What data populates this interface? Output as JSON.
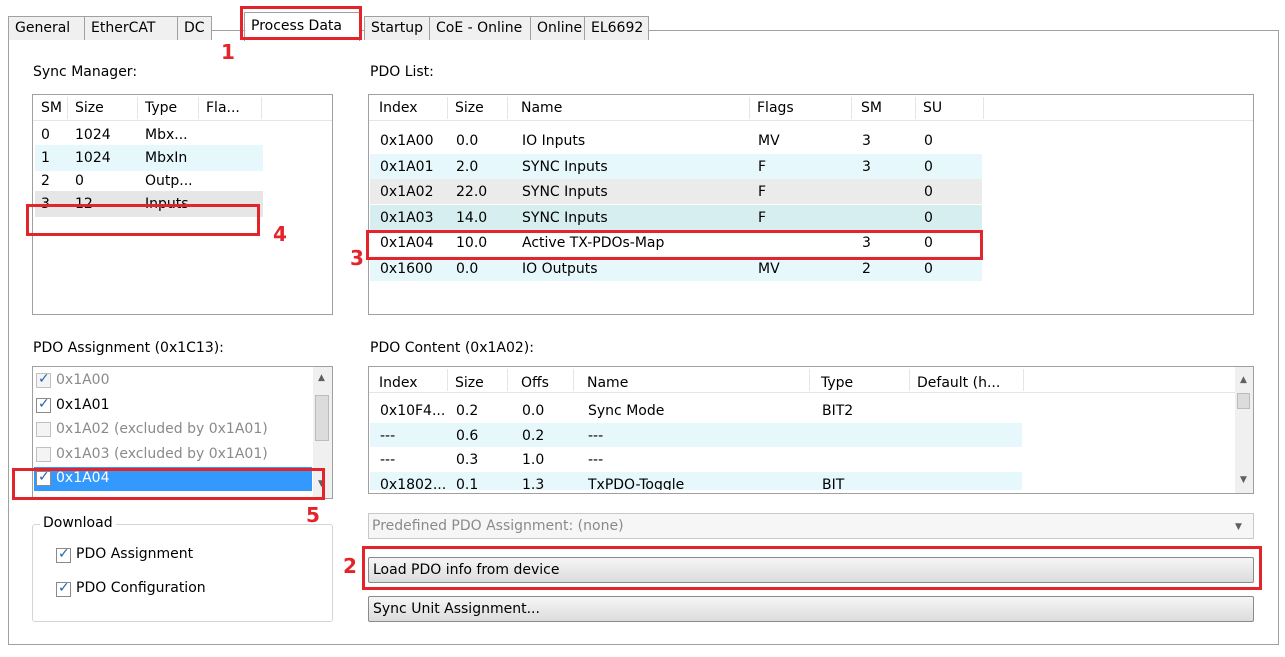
{
  "tabs": [
    "General",
    "EtherCAT",
    "DC",
    "Process Data",
    "Startup",
    "CoE - Online",
    "Online",
    "EL6692"
  ],
  "sync_manager": {
    "label": "Sync Manager:",
    "columns": [
      "SM",
      "Size",
      "Type",
      "Fla..."
    ],
    "rows": [
      {
        "sm": "0",
        "size": "1024",
        "type": "Mbx..."
      },
      {
        "sm": "1",
        "size": "1024",
        "type": "MbxIn"
      },
      {
        "sm": "2",
        "size": "0",
        "type": "Outp..."
      },
      {
        "sm": "3",
        "size": "12",
        "type": "Inputs"
      }
    ]
  },
  "pdo_list": {
    "label": "PDO List:",
    "columns": [
      "Index",
      "Size",
      "Name",
      "Flags",
      "SM",
      "SU"
    ],
    "rows": [
      {
        "index": "0x1A00",
        "size": "0.0",
        "name": "IO Inputs",
        "flags": "MV",
        "sm": "3",
        "su": "0"
      },
      {
        "index": "0x1A01",
        "size": "2.0",
        "name": "SYNC Inputs",
        "flags": "F",
        "sm": "3",
        "su": "0"
      },
      {
        "index": "0x1A02",
        "size": "22.0",
        "name": "SYNC Inputs",
        "flags": "F",
        "sm": "",
        "su": "0"
      },
      {
        "index": "0x1A03",
        "size": "14.0",
        "name": "SYNC Inputs",
        "flags": "F",
        "sm": "",
        "su": "0"
      },
      {
        "index": "0x1A04",
        "size": "10.0",
        "name": "Active TX-PDOs-Map",
        "flags": "",
        "sm": "3",
        "su": "0"
      },
      {
        "index": "0x1600",
        "size": "0.0",
        "name": "IO Outputs",
        "flags": "MV",
        "sm": "2",
        "su": "0"
      }
    ]
  },
  "pdo_assignment": {
    "label": "PDO Assignment (0x1C13):",
    "items": [
      {
        "text": "0x1A00"
      },
      {
        "text": "0x1A01"
      },
      {
        "text": "0x1A02 (excluded by 0x1A01)"
      },
      {
        "text": "0x1A03 (excluded by 0x1A01)"
      },
      {
        "text": "0x1A04"
      }
    ]
  },
  "pdo_content": {
    "label": "PDO Content (0x1A02):",
    "columns": [
      "Index",
      "Size",
      "Offs",
      "Name",
      "Type",
      "Default (h..."
    ],
    "rows": [
      {
        "index": "0x10F4...",
        "size": "0.2",
        "offs": "0.0",
        "name": "Sync Mode",
        "type": "BIT2"
      },
      {
        "index": "---",
        "size": "0.6",
        "offs": "0.2",
        "name": "---",
        "type": ""
      },
      {
        "index": "---",
        "size": "0.3",
        "offs": "1.0",
        "name": "---",
        "type": ""
      },
      {
        "index": "0x1802...",
        "size": "0.1",
        "offs": "1.3",
        "name": "TxPDO-Toggle",
        "type": "BIT"
      }
    ]
  },
  "download": {
    "label": "Download",
    "pdo_assignment": "PDO Assignment",
    "pdo_configuration": "PDO Configuration"
  },
  "predefined_select": "Predefined PDO Assignment: (none)",
  "buttons": {
    "load_pdo": "Load PDO info from device",
    "sync_unit": "Sync Unit Assignment..."
  },
  "annotations": [
    "1",
    "2",
    "3",
    "4",
    "5"
  ],
  "colors": {
    "annotation_red": "#e3242b",
    "selection_blue": "#3399ff",
    "row_alt": "#e6f8fb"
  }
}
